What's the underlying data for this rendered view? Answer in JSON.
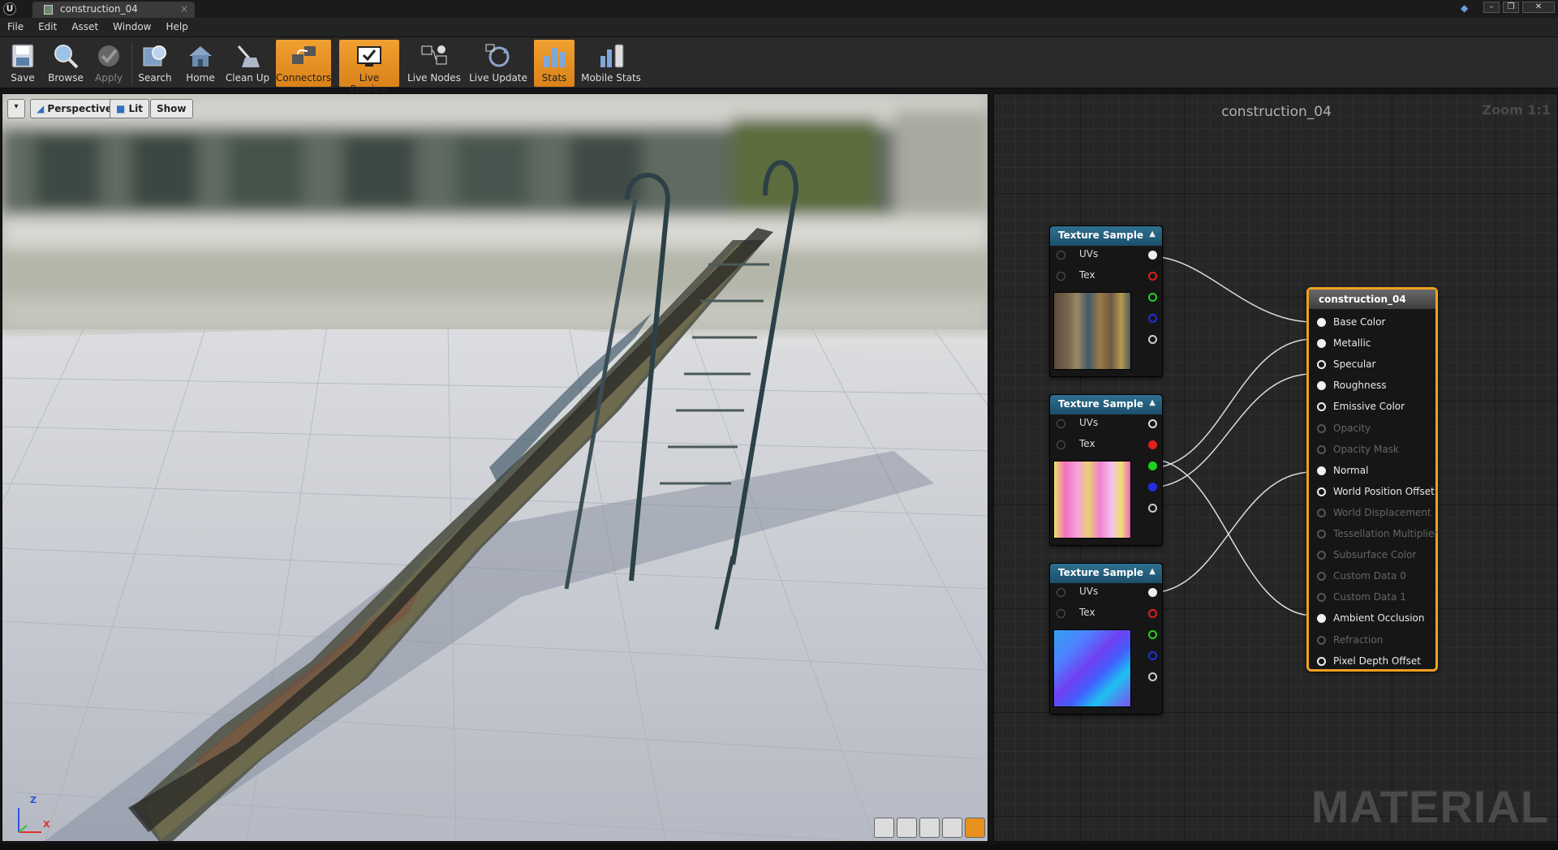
{
  "app": {
    "tab_title": "construction_04",
    "tab_close": "×"
  },
  "menu": [
    "File",
    "Edit",
    "Asset",
    "Window",
    "Help"
  ],
  "toolbar": {
    "buttons": [
      {
        "label": "Save",
        "icon": "save-icon",
        "state": "normal"
      },
      {
        "label": "Browse",
        "icon": "browse-icon",
        "state": "normal"
      },
      {
        "label": "Apply",
        "icon": "apply-icon",
        "state": "disabled"
      },
      {
        "label": "Search",
        "icon": "search-icon",
        "state": "normal"
      },
      {
        "label": "Home",
        "icon": "home-icon",
        "state": "normal"
      },
      {
        "label": "Clean Up",
        "icon": "clean-up-icon",
        "state": "normal"
      },
      {
        "label": "Connectors",
        "icon": "connectors-icon",
        "state": "active"
      },
      {
        "label": "Live Preview",
        "icon": "live-preview-icon",
        "state": "active"
      },
      {
        "label": "Live Nodes",
        "icon": "live-nodes-icon",
        "state": "normal"
      },
      {
        "label": "Live Update",
        "icon": "live-update-icon",
        "state": "normal"
      },
      {
        "label": "Stats",
        "icon": "stats-icon",
        "state": "active"
      },
      {
        "label": "Mobile Stats",
        "icon": "mobile-stats-icon",
        "state": "normal"
      }
    ]
  },
  "viewport": {
    "dropdown": "▾",
    "perspective": "Perspective",
    "lit": "Lit",
    "show": "Show",
    "axis_z": "Z",
    "axis_x": "X"
  },
  "graph": {
    "title": "construction_04",
    "zoom": "Zoom 1:1",
    "watermark": "MATERIAL",
    "texture_nodes": [
      {
        "title": "Texture Sample",
        "inputs": [
          "UVs",
          "Tex"
        ],
        "thumbnail": "base-color-texture"
      },
      {
        "title": "Texture Sample",
        "inputs": [
          "UVs",
          "Tex"
        ],
        "thumbnail": "orm-texture"
      },
      {
        "title": "Texture Sample",
        "inputs": [
          "UVs",
          "Tex"
        ],
        "thumbnail": "normal-map-texture"
      }
    ],
    "material_node": {
      "title": "construction_04",
      "pins": [
        {
          "label": "Base Color",
          "enabled": true,
          "connected": true
        },
        {
          "label": "Metallic",
          "enabled": true,
          "connected": true
        },
        {
          "label": "Specular",
          "enabled": true,
          "connected": false
        },
        {
          "label": "Roughness",
          "enabled": true,
          "connected": true
        },
        {
          "label": "Emissive Color",
          "enabled": true,
          "connected": false
        },
        {
          "label": "Opacity",
          "enabled": false,
          "connected": false
        },
        {
          "label": "Opacity Mask",
          "enabled": false,
          "connected": false
        },
        {
          "label": "Normal",
          "enabled": true,
          "connected": true
        },
        {
          "label": "World Position Offset",
          "enabled": true,
          "connected": false
        },
        {
          "label": "World Displacement",
          "enabled": false,
          "connected": false
        },
        {
          "label": "Tessellation Multiplier",
          "enabled": false,
          "connected": false
        },
        {
          "label": "Subsurface Color",
          "enabled": false,
          "connected": false
        },
        {
          "label": "Custom Data 0",
          "enabled": false,
          "connected": false
        },
        {
          "label": "Custom Data 1",
          "enabled": false,
          "connected": false
        },
        {
          "label": "Ambient Occlusion",
          "enabled": true,
          "connected": true
        },
        {
          "label": "Refraction",
          "enabled": false,
          "connected": false
        },
        {
          "label": "Pixel Depth Offset",
          "enabled": true,
          "connected": false
        }
      ]
    },
    "pin_colors": {
      "rgba": "#eeeeee",
      "r": "#e02020",
      "g": "#20d020",
      "b": "#2030e0",
      "a": "#cccccc"
    }
  },
  "colors": {
    "accent_active": "#e8901e",
    "node_header": "#2e7090",
    "material_border": "#f0a020"
  }
}
